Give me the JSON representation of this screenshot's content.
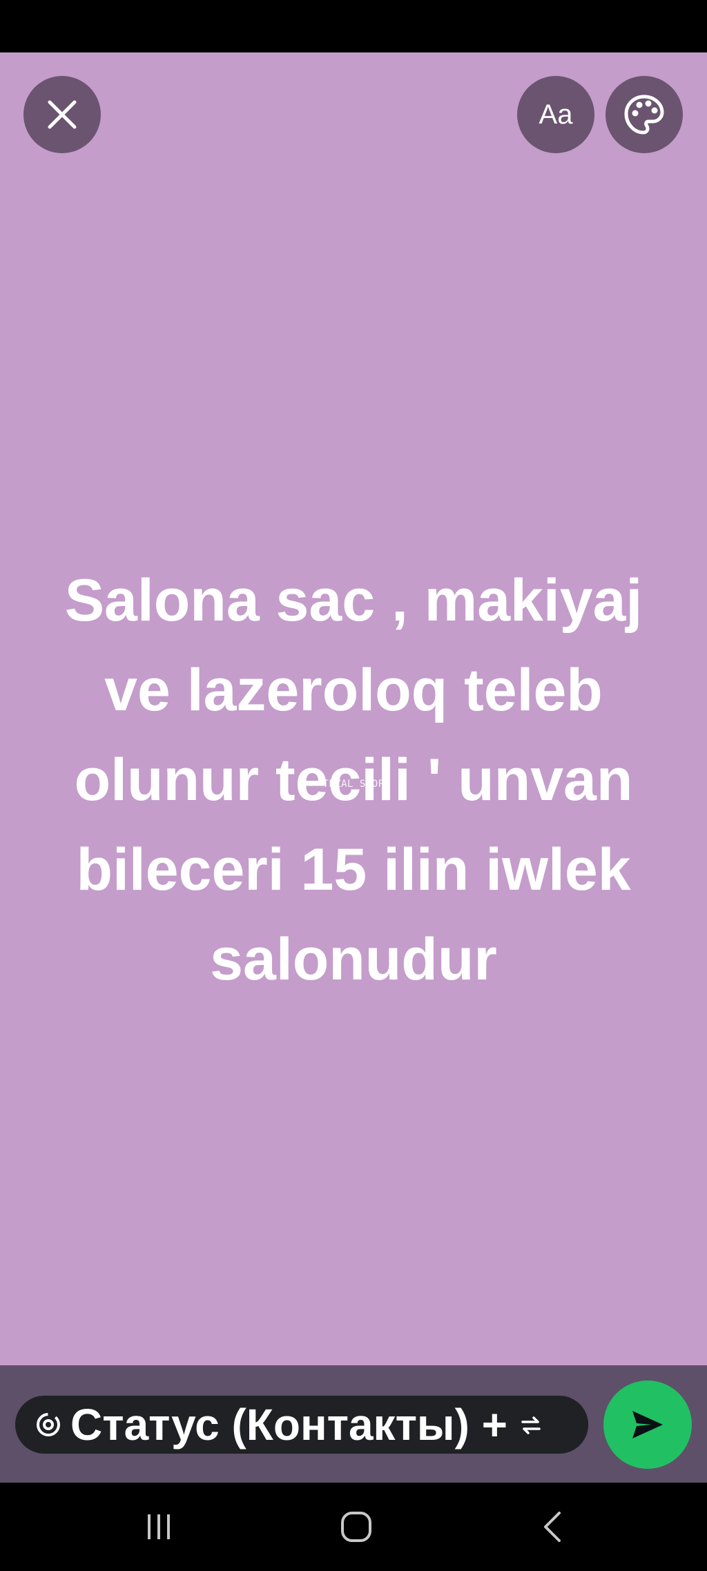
{
  "toolbar": {
    "close_icon": "close-icon",
    "font_button_label": "Aa",
    "palette_icon": "palette-icon"
  },
  "status": {
    "text": "Salona sac , makiyaj ve lazeroloq teleb olunur tecili ' unvan bileceri 15 ilin iwlek salonudur",
    "watermark": "TEZAL SHOP",
    "background_color": "#c49dcb"
  },
  "bottom": {
    "audience_icon": "status-ring-icon",
    "audience_label": "Статус (Контакты) +",
    "audience_trailing_icon": "repeat-icon",
    "send_icon": "send-icon",
    "send_color": "#21c063"
  },
  "navigation": {
    "recents_icon": "recents-icon",
    "home_icon": "home-icon",
    "back_icon": "back-icon"
  }
}
